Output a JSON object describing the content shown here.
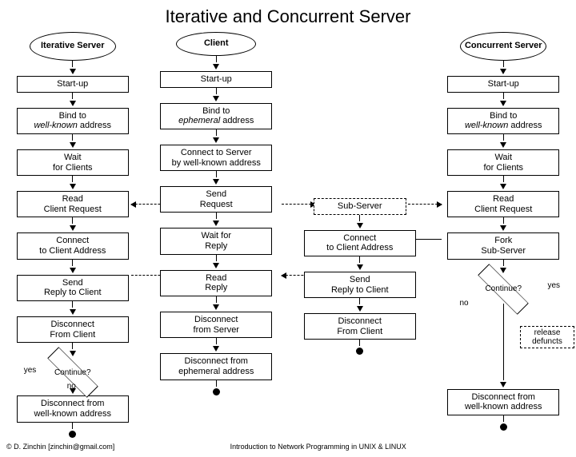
{
  "title": "Iterative and Concurrent Server",
  "headers": {
    "iterative": "Iterative Server",
    "client": "Client",
    "concurrent": "Concurrent Server"
  },
  "col_iter": {
    "startup": "Start-up",
    "bind_a": "Bind to",
    "bind_b_pre": "well-known",
    "bind_b_post": " address",
    "wait_a": "Wait",
    "wait_b": "for Clients",
    "read_a": "Read",
    "read_b": "Client Request",
    "connect_a": "Connect",
    "connect_b": "to Client Address",
    "send_a": "Send",
    "send_b": "Reply to Client",
    "disc_a": "Disconnect",
    "disc_b": "From Client",
    "continue": "Continue?",
    "yes": "yes",
    "no": "no",
    "discwk_a": "Disconnect from",
    "discwk_b": "well-known address"
  },
  "col_client": {
    "startup": "Start-up",
    "bind_a": "Bind to",
    "bind_b_pre": "ephemeral",
    "bind_b_post": " address",
    "conn_a": "Connect to Server",
    "conn_b": "by well-known address",
    "senda": "Send",
    "sendb": "Request",
    "wa": "Wait for",
    "wb": "Reply",
    "ra": "Read",
    "rb": "Reply",
    "da": "Disconnect",
    "db": "from Server",
    "dea": "Disconnect from",
    "deb": "ephemeral address"
  },
  "col_sub": {
    "title": "Sub-Server",
    "ca": "Connect",
    "cb": "to Client Address",
    "sa": "Send",
    "sb": "Reply to Client",
    "da": "Disconnect",
    "db": "From Client"
  },
  "col_conc": {
    "startup": "Start-up",
    "bind_a": "Bind to",
    "bind_b_pre": "well-known",
    "bind_b_post": " address",
    "wait_a": "Wait",
    "wait_b": "for Clients",
    "read_a": "Read",
    "read_b": "Client Request",
    "fork_a": "Fork",
    "fork_b": "Sub-Server",
    "continue": "Continue?",
    "yes": "yes",
    "no": "no",
    "rel_a": "release",
    "rel_b": "defuncts",
    "discwk_a": "Disconnect from",
    "discwk_b": "well-known address"
  },
  "footer": {
    "copyright": "© D. Zinchin [zinchin@gmail.com]",
    "caption": "Introduction to Network Programming in UNIX & LINUX"
  },
  "chart_data": {
    "type": "flowchart",
    "columns": [
      {
        "name": "Iterative Server",
        "nodes": [
          "Start-up",
          "Bind to well-known address",
          "Wait for Clients",
          "Read Client Request",
          "Connect to Client Address",
          "Send Reply to Client",
          "Disconnect From Client",
          "Continue?",
          "Disconnect from well-known address",
          "END"
        ],
        "loop": {
          "decision": "Continue?",
          "yes_target": "Wait for Clients",
          "no_target": "Disconnect from well-known address"
        }
      },
      {
        "name": "Client",
        "nodes": [
          "Start-up",
          "Bind to ephemeral address",
          "Connect to Server by well-known address",
          "Send Request",
          "Wait for Reply",
          "Read Reply",
          "Disconnect from Server",
          "Disconnect from ephemeral address",
          "END"
        ]
      },
      {
        "name": "Sub-Server",
        "nodes": [
          "Sub-Server",
          "Connect to Client Address",
          "Send Reply to Client",
          "Disconnect From Client",
          "END"
        ]
      },
      {
        "name": "Concurrent Server",
        "nodes": [
          "Start-up",
          "Bind to well-known address",
          "Wait for Clients",
          "Read Client Request",
          "Fork Sub-Server",
          "Continue?",
          "Disconnect from well-known address",
          "END"
        ],
        "loop": {
          "decision": "Continue?",
          "yes_target": "Wait for Clients",
          "no_target": "Disconnect from well-known address"
        },
        "side_action": "release defuncts"
      }
    ],
    "cross_edges": [
      {
        "from": "Client:Send Request",
        "to": "Iterative Server:Read Client Request",
        "style": "dashed"
      },
      {
        "from": "Iterative Server:Send Reply to Client",
        "to": "Client:Read Reply",
        "style": "dashed"
      },
      {
        "from": "Client:Send Request",
        "to": "Concurrent Server:Read Client Request",
        "style": "dashed",
        "via": "Sub-Server"
      },
      {
        "from": "Sub-Server:Send Reply to Client",
        "to": "Client:Read Reply",
        "style": "dashed"
      },
      {
        "from": "Concurrent Server:Fork Sub-Server",
        "to": "Sub-Server:Connect to Client Address",
        "style": "solid"
      }
    ]
  }
}
